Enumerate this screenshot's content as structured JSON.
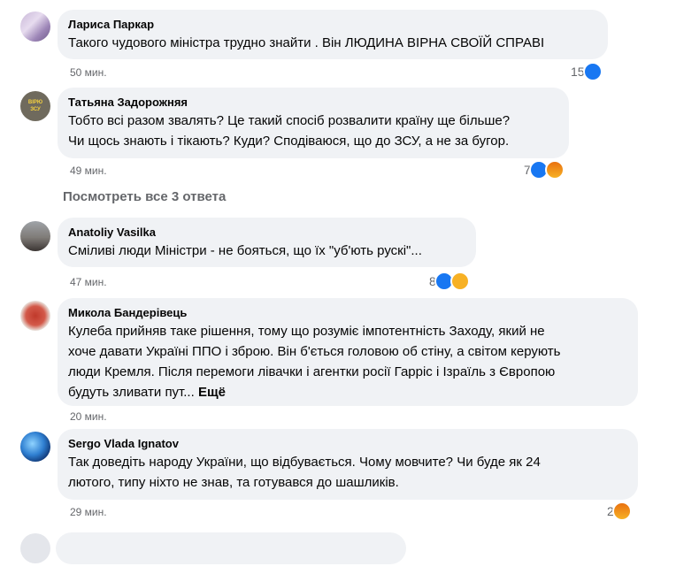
{
  "comments": [
    {
      "author": "Лариса Паркар",
      "lines": [
        "Такого чудового міністра трудно знайти . Він ЛЮДИНА ВІРНА СВОЇЙ СПРАВІ"
      ],
      "time": "50 мин.",
      "reaction_count": "15",
      "reactions": [
        "like-icon"
      ]
    },
    {
      "author": "Татьяна Задорожняя",
      "avatar_text": "ВІРЮ ЗСУ",
      "lines": [
        "Тобто всі разом звалять? Це такий спосіб розвалити країну ще більше?",
        "Чи щось знають і тікають? Куди? Сподіваюся, що до ЗСУ, а не за бугор."
      ],
      "time": "49 мин.",
      "reaction_count": "7",
      "reactions": [
        "like-icon",
        "angry-icon"
      ]
    },
    {
      "author": "Anatoliy Vasilka",
      "lines": [
        "Сміливі люди Міністри - не бояться, що їх \"уб'ють рускі\"..."
      ],
      "time": "47 мин.",
      "reaction_count": "8",
      "reactions": [
        "like-icon",
        "sad-icon"
      ]
    },
    {
      "author": "Микола Бандерівець",
      "lines": [
        "Кулеба прийняв таке рішення, тому що розуміє імпотентність Заходу, який не",
        "хоче давати Україні ППО і зброю. Він б'ється головою об стіну, а світом керують",
        "люди Кремля. Після перемоги лівачки і агентки росії Гарріс і Ізраїль з Європою"
      ],
      "last_line": "будуть зливати пут...",
      "more_label": "Ещё",
      "time": "20 мин."
    },
    {
      "author": "Sergo Vlada Ignatov",
      "lines": [
        "Так доведіть народу України, що відбувається. Чому мовчите? Чи буде як 24",
        "лютого, типу ніхто не знав, та готувався до шашликів."
      ],
      "time": "29 мин.",
      "reaction_count": "2",
      "reactions": [
        "angry-icon"
      ]
    }
  ],
  "view_replies_label": "Посмотреть все 3 ответа",
  "colors": {
    "bubble": "#f0f2f5",
    "meta": "#65676b",
    "like": "#1877f2"
  }
}
